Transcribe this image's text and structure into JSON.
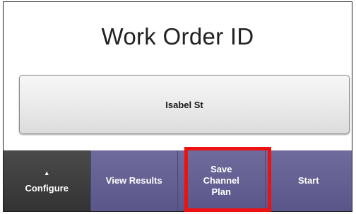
{
  "header": {
    "title": "Work Order ID"
  },
  "field": {
    "value": "Isabel St"
  },
  "toolbar": {
    "configure_label": "Configure",
    "configure_icon": "triangle-up",
    "view_results_label": "View Results",
    "save_plan_label": "Save Channel Plan",
    "start_label": "Start"
  },
  "colors": {
    "toolbar_purple": "#5f5b8f",
    "configure_gray": "#3c3c3c",
    "highlight_red": "#ee1111"
  }
}
